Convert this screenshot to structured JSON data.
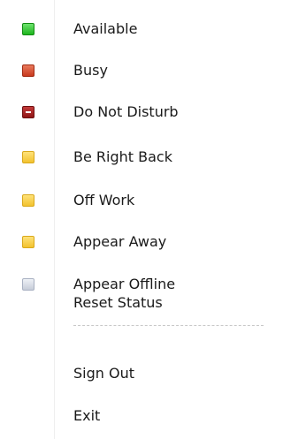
{
  "menu": {
    "items": [
      {
        "label": "Available",
        "icon": "status-available-icon",
        "color": "#1db51d"
      },
      {
        "label": "Busy",
        "icon": "status-busy-icon",
        "color": "#c83a1e"
      },
      {
        "label": "Do Not Disturb",
        "icon": "status-do-not-disturb-icon",
        "color": "#8f1515"
      },
      {
        "label": "Be Right Back",
        "icon": "status-be-right-back-icon",
        "color": "#f2c22e"
      },
      {
        "label": "Off Work",
        "icon": "status-off-work-icon",
        "color": "#f2c22e"
      },
      {
        "label": "Appear Away",
        "icon": "status-appear-away-icon",
        "color": "#f2c22e"
      },
      {
        "label": "Appear Offline",
        "icon": "status-appear-offline-icon",
        "color": "#c6ccd8"
      },
      {
        "label": "Reset Status"
      },
      {
        "label": "Sign Out"
      },
      {
        "label": "Exit"
      }
    ]
  }
}
